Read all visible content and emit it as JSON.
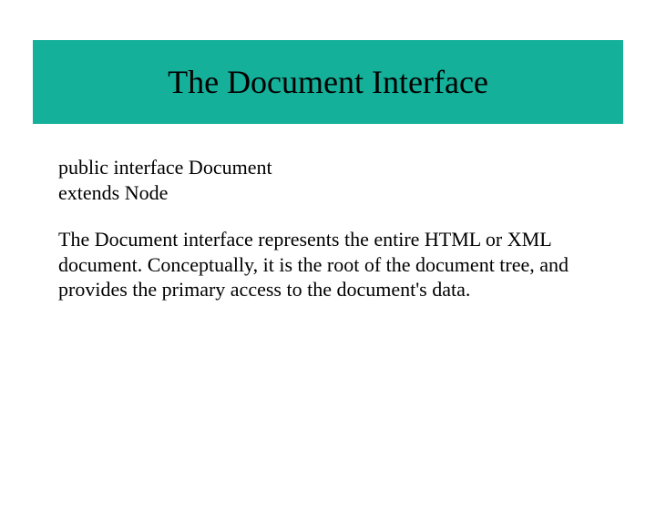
{
  "header": {
    "title": "The Document Interface"
  },
  "declaration": {
    "line1": "public interface Document",
    "line2": "extends Node"
  },
  "description": {
    "text": "The Document interface represents the entire HTML or XML document. Conceptually, it is the root of the document tree, and provides the primary access to the document's data."
  }
}
